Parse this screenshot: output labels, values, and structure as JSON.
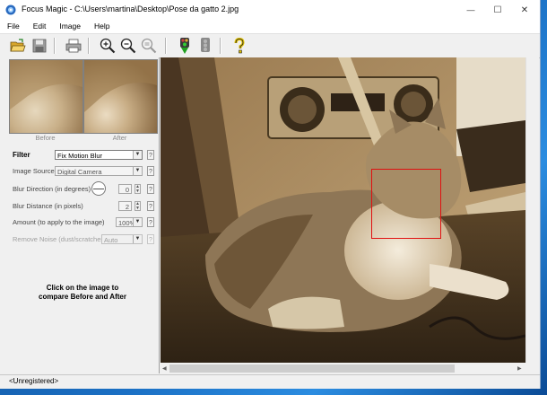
{
  "window": {
    "title": "Focus Magic - C:\\Users\\martina\\Desktop\\Pose da gatto 2.jpg",
    "minimize": "—",
    "maximize": "☐",
    "close": "✕"
  },
  "menu": [
    {
      "label": "File"
    },
    {
      "label": "Edit"
    },
    {
      "label": "Image"
    },
    {
      "label": "Help"
    }
  ],
  "toolbar": {
    "open_icon": "open-folder-icon",
    "save_icon": "save-disk-icon",
    "print_icon": "printer-icon",
    "zoom_in_icon": "zoom-in-icon",
    "zoom_out_icon": "zoom-out-icon",
    "zoom_fit_icon": "zoom-fit-icon",
    "run_icon": "traffic-light-green-icon",
    "stop_icon": "traffic-light-gray-icon",
    "help_icon": "help-question-icon"
  },
  "preview": {
    "before_label": "Before",
    "after_label": "After"
  },
  "settings": {
    "filter_label": "Filter",
    "filter_value": "Fix Motion Blur",
    "source_label": "Image Source",
    "source_value": "Digital Camera",
    "direction_label": "Blur Direction (in degrees)",
    "direction_value": "0",
    "distance_label": "Blur Distance (in pixels)",
    "distance_value": "2",
    "amount_label": "Amount (to apply to the image)",
    "amount_value": "100%",
    "noise_label": "Remove Noise (dust/scratches)",
    "noise_value": "Auto",
    "help_text": "?"
  },
  "instruction": {
    "line1": "Click on the image to",
    "line2": "compare Before and After"
  },
  "status": {
    "text": "<Unregistered>"
  },
  "colors": {
    "selection": "#e01010",
    "sepia_dark": "#4a3720",
    "sepia_light": "#d8c9b0"
  }
}
